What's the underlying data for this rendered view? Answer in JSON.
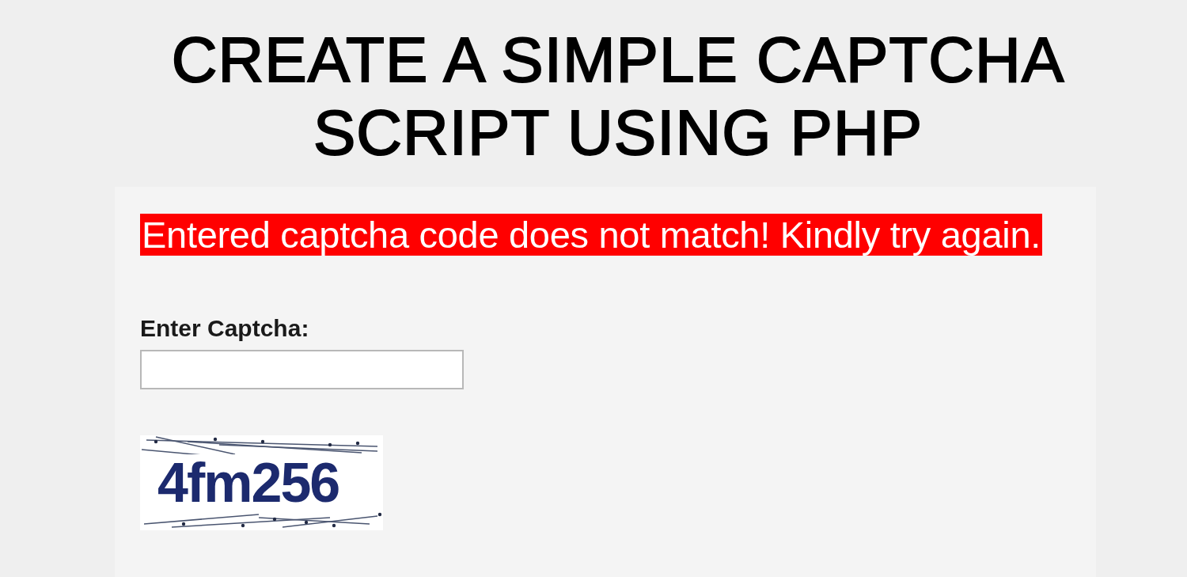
{
  "title": "CREATE A SIMPLE CAPTCHA SCRIPT USING PHP",
  "error_message": "Entered captcha code does not match! Kindly try again.",
  "captcha_label": "Enter Captcha:",
  "captcha_code": "4fm256"
}
